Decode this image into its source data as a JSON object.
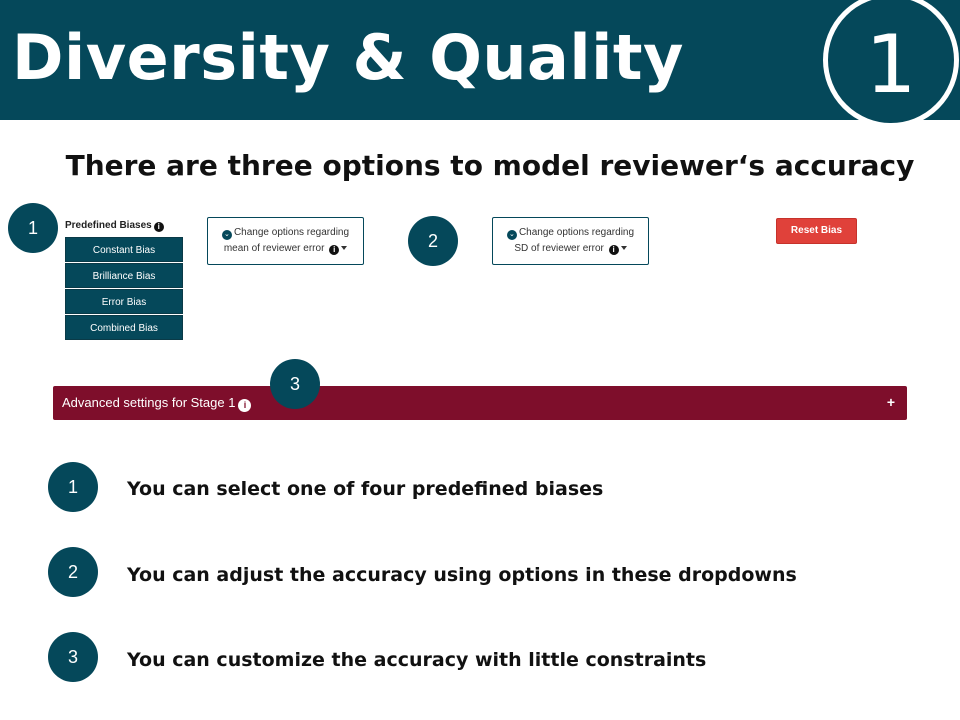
{
  "header": {
    "title": "Diversity & Quality",
    "number": "1"
  },
  "subtitle": "There are three options to model reviewer‘s accuracy",
  "markers": {
    "one": "1",
    "two": "2",
    "three": "3"
  },
  "bias_panel": {
    "heading": "Predefined Biases",
    "items": [
      "Constant Bias",
      "Brilliance Bias",
      "Error Bias",
      "Combined Bias"
    ]
  },
  "dropdowns": {
    "mean": {
      "line1": "Change options regarding",
      "line2": "mean of reviewer error"
    },
    "sd": {
      "line1": "Change options regarding",
      "line2": "SD of reviewer error"
    }
  },
  "reset_button": "Reset Bias",
  "advanced": {
    "label": "Advanced settings for Stage 1",
    "expand": "+"
  },
  "bullets": [
    {
      "num": "1",
      "text": "You can select one of four predefined biases"
    },
    {
      "num": "2",
      "text": "You can adjust the accuracy using options in these dropdowns"
    },
    {
      "num": "3",
      "text": "You can customize the accuracy with little constraints"
    }
  ],
  "colors": {
    "primary": "#05485a",
    "advanced_bar": "#7e0e2b",
    "reset": "#e0413a"
  },
  "icons": [
    "info-icon",
    "chevron-circle-icon",
    "caret-down-icon",
    "plus-icon"
  ]
}
